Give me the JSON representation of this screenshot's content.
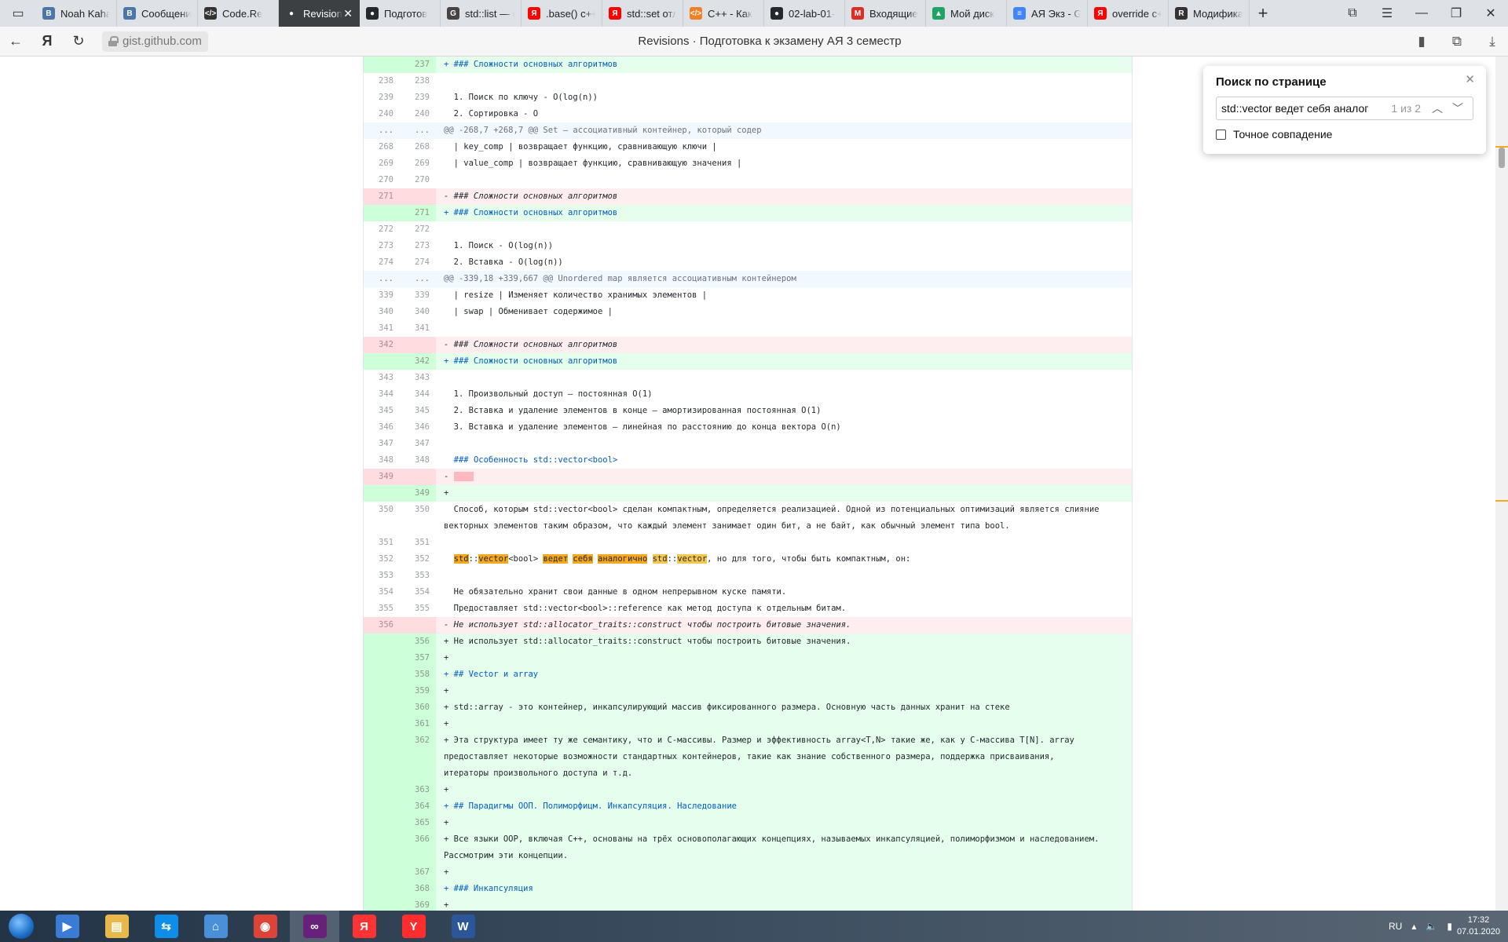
{
  "tabs": [
    {
      "label": "Noah Kaha",
      "icon": "vk-icon",
      "color": "#4a76a8",
      "glyph": "В"
    },
    {
      "label": "Сообщени",
      "icon": "vk-messages-icon",
      "color": "#4a76a8",
      "glyph": "В"
    },
    {
      "label": "Code.Re",
      "icon": "code-icon",
      "color": "#333333",
      "glyph": "</>"
    },
    {
      "label": "Revision",
      "icon": "github-icon",
      "color": "#ffffff",
      "glyph": "●",
      "active": true
    },
    {
      "label": "Подготов",
      "icon": "github-icon",
      "color": "#24292e",
      "glyph": "●"
    },
    {
      "label": "std::list — c",
      "icon": "cppreference-icon",
      "color": "#444444",
      "glyph": "G"
    },
    {
      "label": ".base() c++",
      "icon": "yandex-icon",
      "color": "#ff0000",
      "glyph": "Я"
    },
    {
      "label": "std::set отл",
      "icon": "yandex-icon",
      "color": "#ff0000",
      "glyph": "Я"
    },
    {
      "label": "C++ - Как",
      "icon": "code-icon",
      "color": "#f48024",
      "glyph": "</>"
    },
    {
      "label": "02-lab-01-",
      "icon": "github-icon",
      "color": "#24292e",
      "glyph": "●"
    },
    {
      "label": "Входящие",
      "icon": "gmail-icon",
      "color": "#d93025",
      "glyph": "M"
    },
    {
      "label": "Мой диск",
      "icon": "google-drive-icon",
      "color": "#1fa463",
      "glyph": "▲"
    },
    {
      "label": "АЯ Экз - G",
      "icon": "google-docs-icon",
      "color": "#4285f4",
      "glyph": "≡"
    },
    {
      "label": "override c+",
      "icon": "yandex-icon",
      "color": "#ff0000",
      "glyph": "Я"
    },
    {
      "label": "Модифика",
      "icon": "r-icon",
      "color": "#333333",
      "glyph": "R"
    }
  ],
  "address": {
    "domain": "gist.github.com",
    "title": "Revisions · Подготовка к экзамену АЯ 3 семестр"
  },
  "find": {
    "title": "Поиск по странице",
    "query": "std::vector ведет себя аналог",
    "count": "1 из 2",
    "exact_label": "Точное совпадение"
  },
  "diff_rows": [
    {
      "t": "add",
      "o": "",
      "n": "237",
      "c": "+ ### Сложности основных алгоритмов",
      "cls": "blue"
    },
    {
      "t": "ctx",
      "o": "238",
      "n": "238",
      "c": ""
    },
    {
      "t": "ctx",
      "o": "239",
      "n": "239",
      "c": "  1. Поиск по ключу - O(log(n))"
    },
    {
      "t": "ctx",
      "o": "240",
      "n": "240",
      "c": "  2. Сортировка - O"
    },
    {
      "t": "hunk",
      "o": "...",
      "n": "...",
      "c": "@@ -268,7 +268,7 @@ Set — ассоциативный контейнер, который содер"
    },
    {
      "t": "ctx",
      "o": "268",
      "n": "268",
      "c": "  | key_comp | возвращает функцию, сравнивающую ключи |"
    },
    {
      "t": "ctx",
      "o": "269",
      "n": "269",
      "c": "  | value_comp | возвращает функцию, сравнивающую значения |"
    },
    {
      "t": "ctx",
      "o": "270",
      "n": "270",
      "c": ""
    },
    {
      "t": "del",
      "o": "271",
      "n": "",
      "c": "- ### Сложности основных алгоритмов",
      "cls": "ital"
    },
    {
      "t": "add",
      "o": "",
      "n": "271",
      "c": "+ ### Сложности основных алгоритмов",
      "cls": "blue"
    },
    {
      "t": "ctx",
      "o": "272",
      "n": "272",
      "c": ""
    },
    {
      "t": "ctx",
      "o": "273",
      "n": "273",
      "c": "  1. Поиск - O(log(n))"
    },
    {
      "t": "ctx",
      "o": "274",
      "n": "274",
      "c": "  2. Вставка - O(log(n))"
    },
    {
      "t": "hunk",
      "o": "...",
      "n": "...",
      "c": "@@ -339,18 +339,667 @@ Unordered map является ассоциативным контейнером"
    },
    {
      "t": "ctx",
      "o": "339",
      "n": "339",
      "c": "  | resize | Изменяет количество хранимых элементов |"
    },
    {
      "t": "ctx",
      "o": "340",
      "n": "340",
      "c": "  | swap | Обменивает содержимое |"
    },
    {
      "t": "ctx",
      "o": "341",
      "n": "341",
      "c": ""
    },
    {
      "t": "del",
      "o": "342",
      "n": "",
      "c": "- ### Сложности основных алгоритмов",
      "cls": "ital"
    },
    {
      "t": "add",
      "o": "",
      "n": "342",
      "c": "+ ### Сложности основных алгоритмов",
      "cls": "blue"
    },
    {
      "t": "ctx",
      "o": "343",
      "n": "343",
      "c": ""
    },
    {
      "t": "ctx",
      "o": "344",
      "n": "344",
      "c": "  1. Произвольный доступ — постоянная O(1)"
    },
    {
      "t": "ctx",
      "o": "345",
      "n": "345",
      "c": "  2. Вставка и удаление элементов в конце — амортизированная постоянная O(1)"
    },
    {
      "t": "ctx",
      "o": "346",
      "n": "346",
      "c": "  3. Вставка и удаление элементов — линейная по расстоянию до конца вектора O(n)"
    },
    {
      "t": "ctx",
      "o": "347",
      "n": "347",
      "c": ""
    },
    {
      "t": "ctx",
      "o": "348",
      "n": "348",
      "c": "  ### Особенность std::vector<bool>",
      "cls": "blue"
    },
    {
      "t": "del",
      "o": "349",
      "n": "",
      "c": "- "
    },
    {
      "t": "add",
      "o": "",
      "n": "349",
      "c": "+"
    },
    {
      "t": "ctx",
      "o": "350",
      "n": "350",
      "c": "  Способ, которым std::vector<bool> сделан компактным, определяется реализацией. Одной из потенциальных оптимизаций является слияние векторных элементов таким образом, что каждый элемент занимает один бит, а не байт, как обычный элемент типа bool."
    },
    {
      "t": "ctx",
      "o": "351",
      "n": "351",
      "c": ""
    },
    {
      "t": "ctx",
      "o": "352",
      "n": "352",
      "c": "  std::vector<bool> ведет себя аналогично std::vector, но для того, чтобы быть компактным, он:",
      "match": true
    },
    {
      "t": "ctx",
      "o": "353",
      "n": "353",
      "c": ""
    },
    {
      "t": "ctx",
      "o": "354",
      "n": "354",
      "c": "  Не обязательно хранит свои данные в одном непрерывном куске памяти."
    },
    {
      "t": "ctx",
      "o": "355",
      "n": "355",
      "c": "  Предоставляет std::vector<bool>::reference как метод доступа к отдельным битам."
    },
    {
      "t": "del",
      "o": "356",
      "n": "",
      "c": "- Не использует std::allocator_traits::construct чтобы построить битовые значения.",
      "cls": "ital"
    },
    {
      "t": "add",
      "o": "",
      "n": "356",
      "c": "+ Не использует std::allocator_traits::construct чтобы построить битовые значения."
    },
    {
      "t": "add",
      "o": "",
      "n": "357",
      "c": "+"
    },
    {
      "t": "add",
      "o": "",
      "n": "358",
      "c": "+ ## Vector и array",
      "cls": "blue"
    },
    {
      "t": "add",
      "o": "",
      "n": "359",
      "c": "+"
    },
    {
      "t": "add",
      "o": "",
      "n": "360",
      "c": "+ std::array - это контейнер, инкапсулирующий массив фиксированного размера. Основную часть данных хранит на стеке"
    },
    {
      "t": "add",
      "o": "",
      "n": "361",
      "c": "+"
    },
    {
      "t": "add",
      "o": "",
      "n": "362",
      "c": "+ Эта структура имеет ту же семантику, что и C-массивы. Размер и эффективность array<T,N> такие же, как у C-массива T[N]. array предоставляет некоторые возможности стандартных контейнеров, такие как знание собственного размера, поддержка присваивания, итераторы произвольного доступа и т.д."
    },
    {
      "t": "add",
      "o": "",
      "n": "363",
      "c": "+"
    },
    {
      "t": "add",
      "o": "",
      "n": "364",
      "c": "+ ## Парадигмы ООП. Полиморфицм. Инкапсуляция. Наследование",
      "cls": "blue"
    },
    {
      "t": "add",
      "o": "",
      "n": "365",
      "c": "+"
    },
    {
      "t": "add",
      "o": "",
      "n": "366",
      "c": "+ Все языки OOP, включая C++, основаны на трёх основополагающих концепциях, называемых инкапсуляцией, полиморфизмом и наследованием. Рассмотрим эти концепции."
    },
    {
      "t": "add",
      "o": "",
      "n": "367",
      "c": "+"
    },
    {
      "t": "add",
      "o": "",
      "n": "368",
      "c": "+ ### Инкапсуляция",
      "cls": "blue"
    },
    {
      "t": "add",
      "o": "",
      "n": "369",
      "c": "+"
    }
  ],
  "taskbar": {
    "apps": [
      {
        "name": "media-player-icon",
        "color": "#3a7bd5",
        "glyph": "▶"
      },
      {
        "name": "file-explorer-icon",
        "color": "#e8b84a",
        "glyph": "▤"
      },
      {
        "name": "teamviewer-icon",
        "color": "#0e8ee9",
        "glyph": "⇆"
      },
      {
        "name": "network-app-icon",
        "color": "#4a90d9",
        "glyph": "⌂"
      },
      {
        "name": "chrome-icon",
        "color": "#db4437",
        "glyph": "◉"
      },
      {
        "name": "visual-studio-icon",
        "color": "#68217a",
        "glyph": "∞",
        "active": true
      },
      {
        "name": "yandex-browser-icon",
        "color": "#ff3333",
        "glyph": "Я"
      },
      {
        "name": "yandex-icon",
        "color": "#ff2d2d",
        "glyph": "Y"
      },
      {
        "name": "word-icon",
        "color": "#2b579a",
        "glyph": "W"
      }
    ],
    "lang": "RU",
    "time": "17:32",
    "date": "07.01.2020"
  }
}
